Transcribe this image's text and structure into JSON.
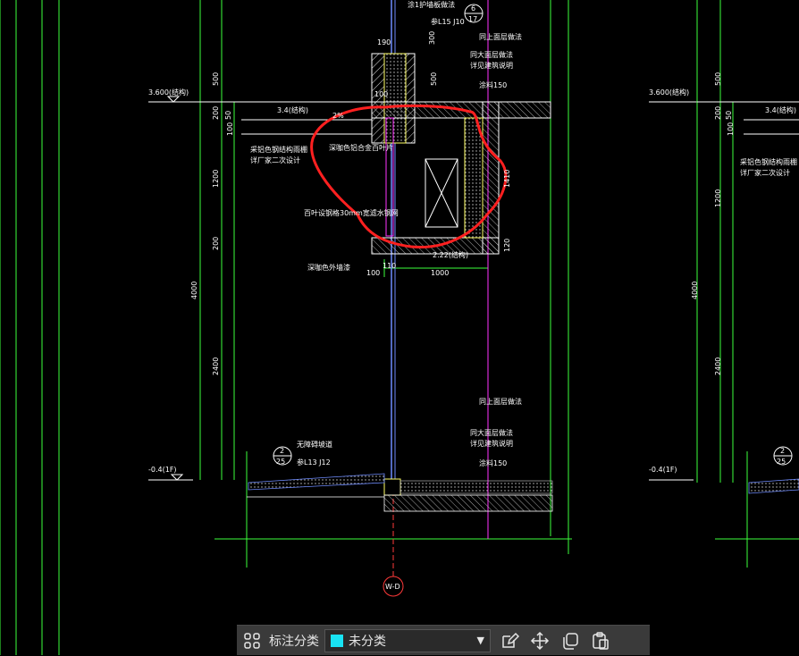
{
  "drawing": {
    "annotations": {
      "note_top": "涂1护墙板做法",
      "ref_top": "参L15 J10",
      "detail_top_num": "6",
      "detail_top_sheet": "17",
      "dim_190": "190",
      "dim_300": "300",
      "dim_500a": "500",
      "dim_500b": "500",
      "dim_1200": "1200",
      "dim_200a": "200",
      "dim_200b": "200",
      "dim_50": "50",
      "dim_100a": "100",
      "dim_100b": "100",
      "dim_110": "110",
      "dim_1000": "1000",
      "dim_4000": "4000",
      "dim_2400": "2400",
      "dim_120": "120",
      "dim_100c": "100",
      "dim_1410": "1410",
      "level_3600": "3.600(结构)",
      "level_3_4": "3.4(结构)",
      "level_2_22": "2.22(结构)",
      "level_minus_0_4": "-0.4(1F)",
      "slope": "2%",
      "note_curtain": "采铝色钢结构雨棚",
      "note_curtain2": "详厂家二次设计",
      "note_alloy": "深咖色铝合金百叶片",
      "note_louver": "百叶设钢格30mm宽滤水钢网",
      "note_paint": "深咖色外墙漆",
      "note_same1": "同大面层做法",
      "note_same2": "详见建筑说明",
      "note_same3": "同大面层做法",
      "note_same4": "详见建筑说明",
      "note_label1": "同上面层做法",
      "note_label2": "同上面层做法",
      "note_s150": "涂料150",
      "note_s150b": "涂料150",
      "note_ground": "无障碍坡道",
      "ref_ground": "参L13 J12",
      "detail_bottom_num": "2",
      "detail_bottom_sheet": "25",
      "axis_label": "W-D",
      "right_level_3600": "3.600(结构)",
      "right_level_3_4": "3.4(结构)",
      "right_note": "采铝色钢结构雨棚",
      "right_note2": "详厂家二次设计",
      "right_level_minus": "-0.4(1F)",
      "right_detail_num": "2",
      "right_detail_sheet": "25",
      "right_dim_500": "500",
      "right_dim_1200": "1200",
      "right_dim_200": "200",
      "right_dim_4000": "4000",
      "right_dim_2400": "2400",
      "right_dim_50": "50",
      "right_dim_100": "100"
    }
  },
  "toolbar": {
    "grid_icon": "grid-icon",
    "label": "标注分类",
    "select_value": "未分类",
    "swatch_color": "#19e3f3",
    "edit_icon": "edit-icon",
    "move_icon": "move-icon",
    "copy_icon": "copy-icon",
    "paste_icon": "paste-icon"
  }
}
